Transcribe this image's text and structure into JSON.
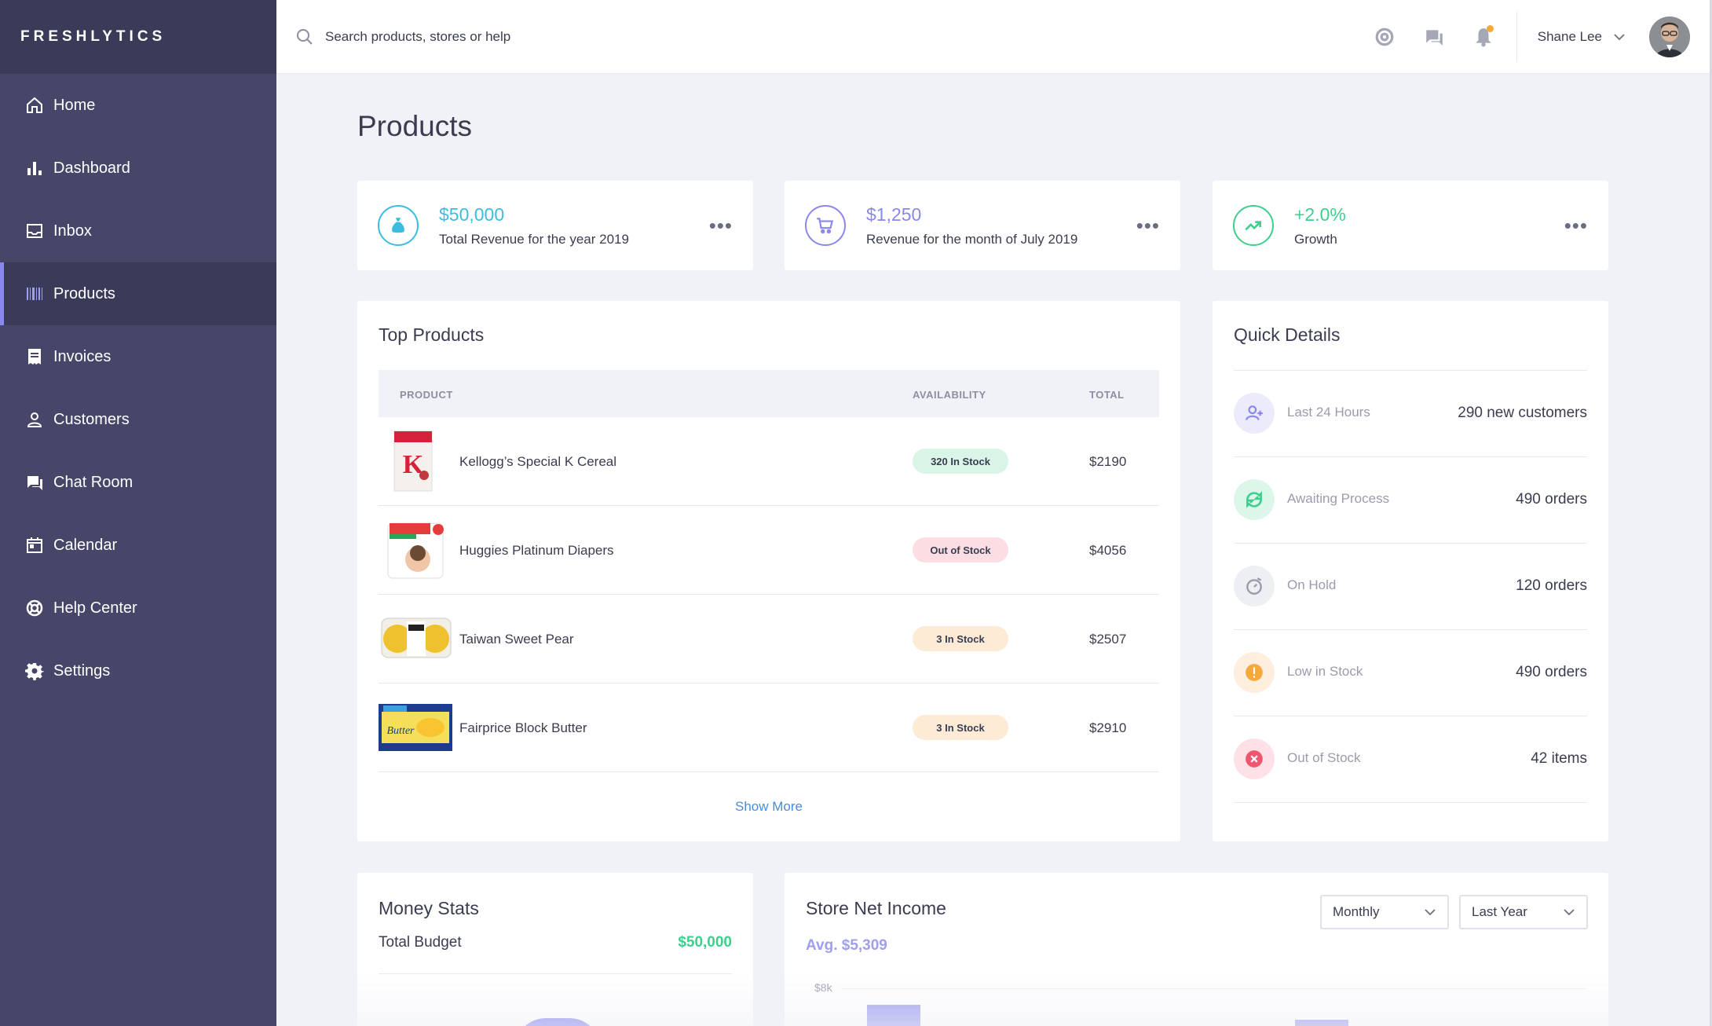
{
  "brand": "FRESHLYTICS",
  "sidebar": {
    "items": [
      {
        "label": "Home",
        "icon": "home-icon"
      },
      {
        "label": "Dashboard",
        "icon": "bar-chart-icon"
      },
      {
        "label": "Inbox",
        "icon": "inbox-icon"
      },
      {
        "label": "Products",
        "icon": "barcode-icon",
        "active": true
      },
      {
        "label": "Invoices",
        "icon": "receipt-icon"
      },
      {
        "label": "Customers",
        "icon": "user-icon"
      },
      {
        "label": "Chat Room",
        "icon": "chat-icon"
      },
      {
        "label": "Calendar",
        "icon": "calendar-icon"
      },
      {
        "label": "Help Center",
        "icon": "lifebuoy-icon"
      },
      {
        "label": "Settings",
        "icon": "gear-icon"
      }
    ]
  },
  "search": {
    "placeholder": "Search products, stores or help"
  },
  "user": {
    "name": "Shane Lee"
  },
  "page": {
    "title": "Products"
  },
  "stats": [
    {
      "value": "$50,000",
      "label": "Total Revenue for the year 2019",
      "color": "#3bbde0",
      "icon": "money-bag-icon"
    },
    {
      "value": "$1,250",
      "label": "Revenue for the month of July 2019",
      "color": "#8a87ee",
      "icon": "cart-icon"
    },
    {
      "value": "+2.0%",
      "label": "Growth",
      "color": "#3ecf8e",
      "icon": "trending-up-icon"
    }
  ],
  "top_products": {
    "title": "Top Products",
    "columns": [
      "PRODUCT",
      "AVAILABILITY",
      "TOTAL"
    ],
    "rows": [
      {
        "name": "Kellogg’s Special K Cereal",
        "availability": "320 In Stock",
        "status": "green",
        "total": "$2190"
      },
      {
        "name": "Huggies Platinum Diapers",
        "availability": "Out of Stock",
        "status": "red",
        "total": "$4056"
      },
      {
        "name": "Taiwan Sweet Pear",
        "availability": "3 In Stock",
        "status": "orange",
        "total": "$2507"
      },
      {
        "name": "Fairprice Block Butter",
        "availability": "3 In Stock",
        "status": "orange",
        "total": "$2910"
      }
    ],
    "show_more": "Show More"
  },
  "quick_details": {
    "title": "Quick Details",
    "rows": [
      {
        "label": "Last 24 Hours",
        "value": "290 new customers",
        "icon": "add-user-icon",
        "color": "#8a87ee",
        "bg": "#ecebfc"
      },
      {
        "label": "Awaiting Process",
        "value": "490 orders",
        "icon": "refresh-icon",
        "color": "#3ecf8e",
        "bg": "#dcf6ea"
      },
      {
        "label": "On Hold",
        "value": "120 orders",
        "icon": "timer-icon",
        "color": "#9a9cab",
        "bg": "#eeeff3"
      },
      {
        "label": "Low in Stock",
        "value": "490 orders",
        "icon": "alert-icon",
        "color": "#f6a93b",
        "bg": "#fdeedd"
      },
      {
        "label": "Out of Stock",
        "value": "42 items",
        "icon": "close-circle-icon",
        "color": "#f0556f",
        "bg": "#fde1e6"
      }
    ]
  },
  "money_stats": {
    "title": "Money Stats",
    "budget_label": "Total Budget",
    "budget_value": "$50,000"
  },
  "store_net_income": {
    "title": "Store Net Income",
    "avg": "Avg. $5,309",
    "period_select": "Monthly",
    "range_select": "Last Year",
    "y_tick": "$8k"
  },
  "colors": {
    "sidebar": "#464669",
    "sidebar_active": "#3a3a59",
    "accent": "#8a87ee",
    "green": "#3ecf8e",
    "link": "#4a8bd9"
  }
}
